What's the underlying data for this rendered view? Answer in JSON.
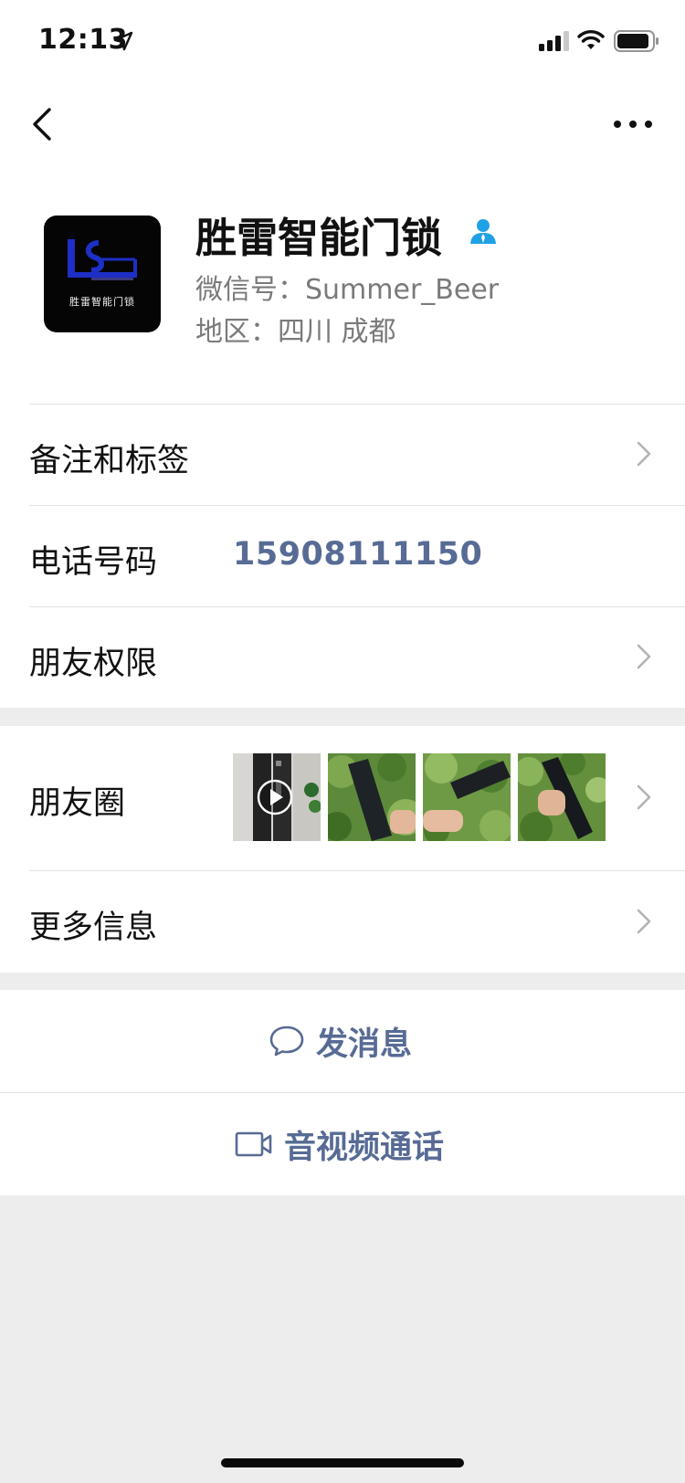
{
  "status_bar": {
    "time": "12:13",
    "icons": [
      "location-arrow-icon",
      "signal-icon",
      "wifi-icon",
      "battery-icon"
    ]
  },
  "nav": {
    "back_icon": "chevron-left-icon",
    "more_icon": "more-dots-icon"
  },
  "profile": {
    "avatar_logo_text": "胜雷智能门锁",
    "name": "胜雷智能门锁",
    "verified_icon": "person-icon",
    "wechat_id": "微信号：Summer_Beer",
    "region": "地区：四川 成都"
  },
  "rows": {
    "remark_tags": {
      "label": "备注和标签"
    },
    "phone": {
      "label": "电话号码",
      "value": "15908111150"
    },
    "friend_permissions": {
      "label": "朋友权限"
    },
    "moments": {
      "label": "朋友圈"
    },
    "more_info": {
      "label": "更多信息"
    }
  },
  "actions": {
    "send_message": {
      "label": "发消息",
      "icon": "chat-bubble-icon"
    },
    "video_call": {
      "label": "音视频通话",
      "icon": "video-camera-icon"
    }
  },
  "colors": {
    "link_blue": "#576b95",
    "background": "#ededed",
    "verified_blue": "#1fa1e6"
  }
}
